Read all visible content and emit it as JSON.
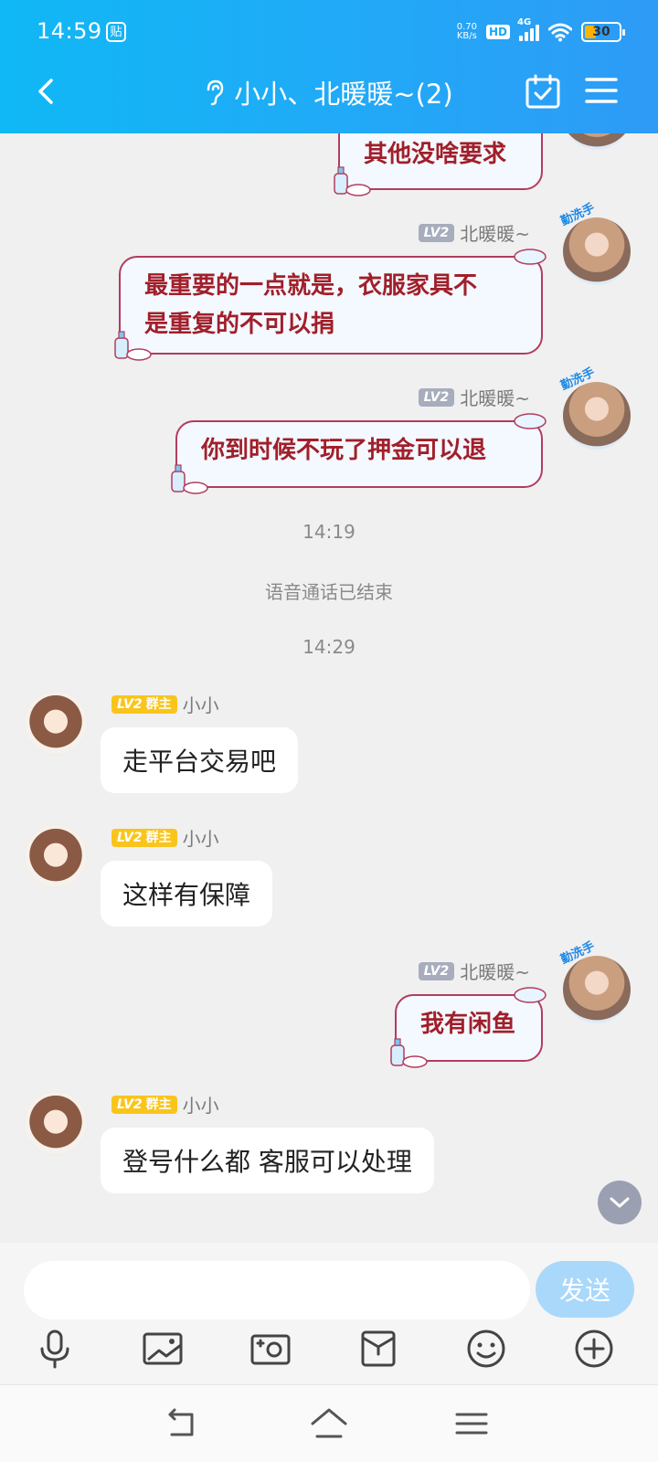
{
  "status_bar": {
    "time": "14:59",
    "notif_icon_char": "贴",
    "net_speed_value": "0.70",
    "net_speed_unit": "KB/s",
    "hd_label": "HD",
    "network_label": "4G",
    "battery_level": "30"
  },
  "header": {
    "title": "小小、北暖暖~(2)",
    "icons": [
      "back-icon",
      "ear-icon",
      "calendar-check-icon",
      "menu-icon"
    ]
  },
  "messages": [
    {
      "side": "right",
      "text": "其他没啥要求"
    },
    {
      "side": "right",
      "level": "LV2",
      "name": "北暖暖~",
      "lines": [
        "最重要的一点就是，衣服家具不",
        "是重复的不可以捐"
      ]
    },
    {
      "side": "right",
      "level": "LV2",
      "name": "北暖暖~",
      "text": "你到时候不玩了押金可以退"
    },
    {
      "side": "left",
      "level": "LV2",
      "role": "群主",
      "name": "小小",
      "text": "走平台交易吧"
    },
    {
      "side": "left",
      "level": "LV2",
      "role": "群主",
      "name": "小小",
      "text": "这样有保障"
    },
    {
      "side": "right",
      "level": "LV2",
      "name": "北暖暖~",
      "text": "我有闲鱼"
    },
    {
      "side": "left",
      "level": "LV2",
      "role": "群主",
      "name": "小小",
      "text": "登号什么都 客服可以处理"
    }
  ],
  "timestamps": [
    "14:19",
    "14:29"
  ],
  "system_note": "语音通话已结束",
  "avatar_decor": "勤洗手",
  "input": {
    "placeholder": "",
    "send_label": "发送"
  },
  "toolbar_icons": [
    "microphone-icon",
    "image-icon",
    "camera-icon",
    "folder-icon",
    "emoji-icon",
    "plus-icon"
  ],
  "navbar_icons": [
    "back-nav-icon",
    "home-nav-icon",
    "recent-apps-icon"
  ],
  "colors": {
    "header_gradient_start": "#10b8f5",
    "header_gradient_end": "#2e9bf6",
    "fancy_text": "#a01f2a",
    "fancy_border": "#b13d5f",
    "owner_badge": "#f9c51d",
    "level_badge": "#a7adbd",
    "send_button": "#a9d8fb"
  }
}
